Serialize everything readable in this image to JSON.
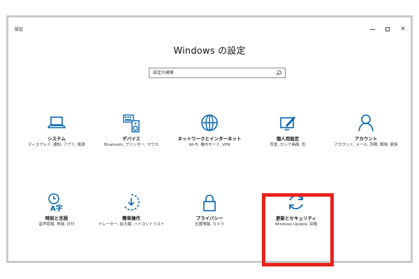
{
  "window": {
    "title": "設定",
    "controls": {
      "minimize": "–",
      "maximize": "□",
      "close": "✕"
    }
  },
  "main": {
    "title": "Windows の設定",
    "search": {
      "placeholder": "設定の検索",
      "icon": "search-icon"
    }
  },
  "tiles": [
    {
      "name": "システム",
      "desc": "ディスプレイ, 通知, アプリ, 電源",
      "icon": "laptop-icon"
    },
    {
      "name": "デバイス",
      "desc": "Bluetooth, プリンター, マウス",
      "icon": "keyboard-speaker-icon"
    },
    {
      "name": "ネットワークとインターネット",
      "desc": "Wi-Fi, 機内モード, VPN",
      "icon": "globe-icon"
    },
    {
      "name": "個人用設定",
      "desc": "背景, ロック画面, 色",
      "icon": "paint-monitor-icon"
    },
    {
      "name": "アカウント",
      "desc": "アカウント, メール, 同期, 職場, 家族",
      "icon": "person-icon"
    },
    {
      "name": "時刻と言語",
      "desc": "音声認識, 地域, 日付",
      "icon": "clock-language-icon"
    },
    {
      "name": "簡単操作",
      "desc": "ナレーター, 拡大鏡, ハイコントラスト",
      "icon": "ease-of-access-icon"
    },
    {
      "name": "プライバシー",
      "desc": "位置情報, カメラ",
      "icon": "lock-icon"
    },
    {
      "name": "更新とセキュリティ",
      "desc": "Windows Update, 回復",
      "icon": "sync-arrows-icon"
    }
  ],
  "highlight": {
    "target": "更新とセキュリティ",
    "color": "#e8221a"
  },
  "colors": {
    "accent": "#0063b1",
    "highlight": "#e8221a",
    "frame": "#c9c9c9"
  }
}
